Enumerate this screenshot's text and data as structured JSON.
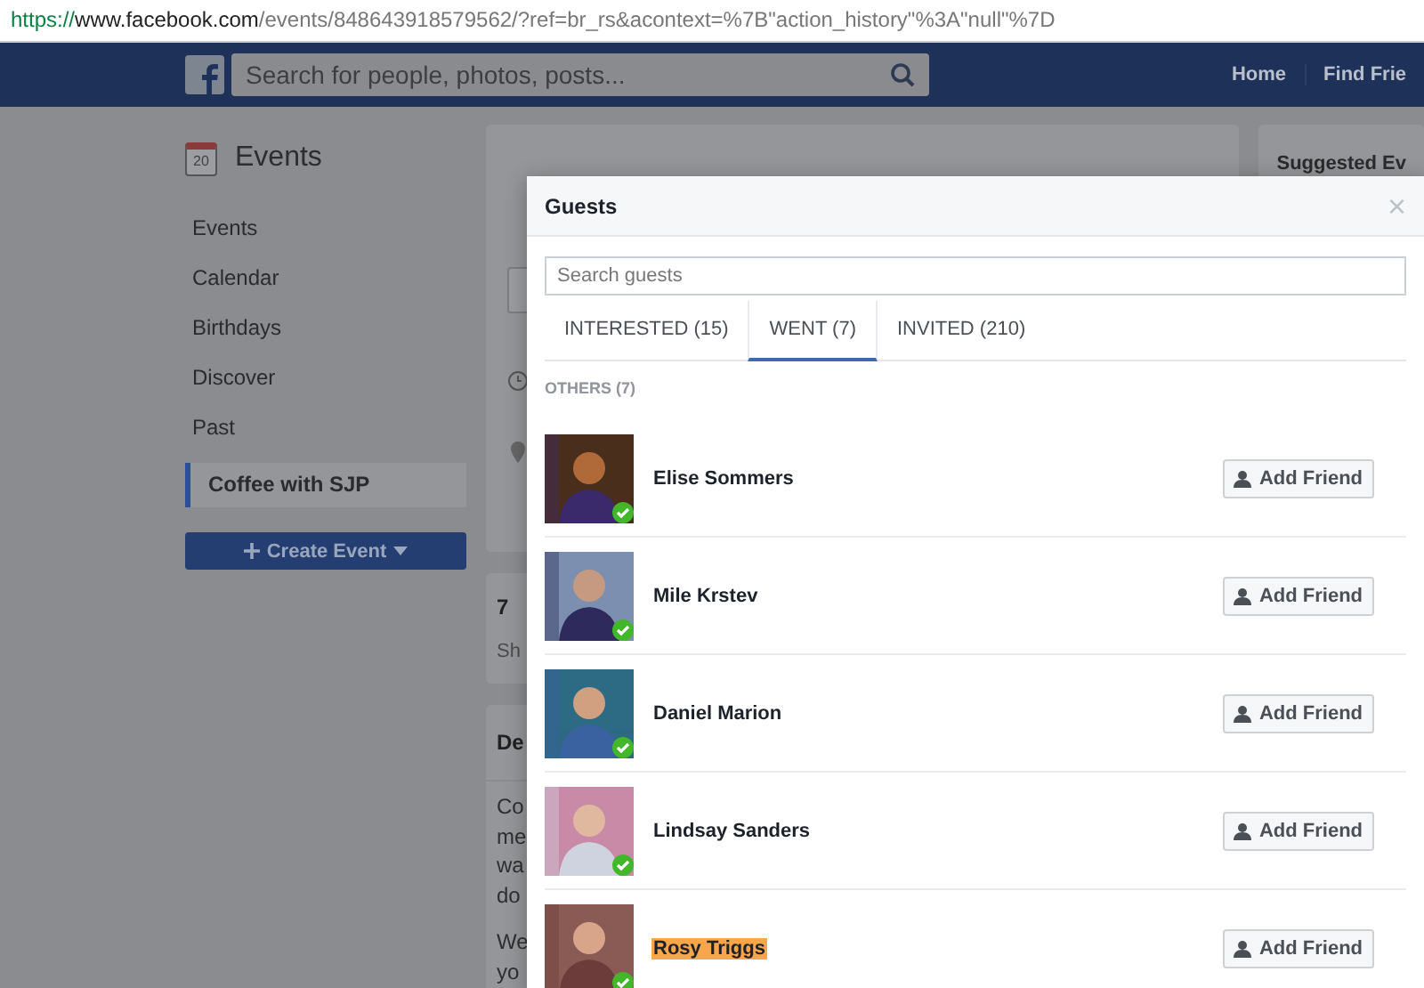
{
  "url": {
    "scheme": "https://",
    "host": "www.facebook.com",
    "path": "/events/848643918579562/?ref=br_rs&acontext=%7B\"action_history\"%3A\"null\"%7D"
  },
  "navbar": {
    "search_placeholder": "Search for people, photos, posts...",
    "links": [
      "Home",
      "Find Frie"
    ]
  },
  "sidebar": {
    "calendar_day": "20",
    "title": "Events",
    "items": [
      {
        "label": "Events",
        "selected": false
      },
      {
        "label": "Calendar",
        "selected": false
      },
      {
        "label": "Birthdays",
        "selected": false
      },
      {
        "label": "Discover",
        "selected": false
      },
      {
        "label": "Past",
        "selected": false
      },
      {
        "label": "Coffee with SJP",
        "selected": true
      }
    ],
    "create_button": "Create Event"
  },
  "cards": [
    {
      "heading": "7",
      "paragraphs": [
        [
          "Sh"
        ]
      ]
    },
    {
      "heading": "De",
      "paragraphs": [
        [
          "Co",
          "me",
          "wa",
          "do"
        ],
        [
          "We",
          "yo"
        ]
      ]
    }
  ],
  "suggested": {
    "title": "Suggested Ev"
  },
  "dialog": {
    "title": "Guests",
    "close": "×",
    "search": {
      "placeholder": "Search guests"
    },
    "tabs": [
      {
        "label": "INTERESTED (15)",
        "selected": false
      },
      {
        "label": "WENT (7)",
        "selected": true
      },
      {
        "label": "INVITED (210)",
        "selected": false
      }
    ],
    "section": "OTHERS (7)",
    "guests": [
      {
        "name": "Elise Sommers",
        "went": true,
        "highlighted": false,
        "action": "Add Friend"
      },
      {
        "name": "Mile Krstev",
        "went": true,
        "highlighted": false,
        "action": "Add Friend"
      },
      {
        "name": "Daniel Marion",
        "went": true,
        "highlighted": false,
        "action": "Add Friend"
      },
      {
        "name": "Lindsay Sanders",
        "went": true,
        "highlighted": false,
        "action": "Add Friend"
      },
      {
        "name": "Rosy Triggs",
        "went": true,
        "highlighted": true,
        "action": "Add Friend"
      }
    ]
  }
}
